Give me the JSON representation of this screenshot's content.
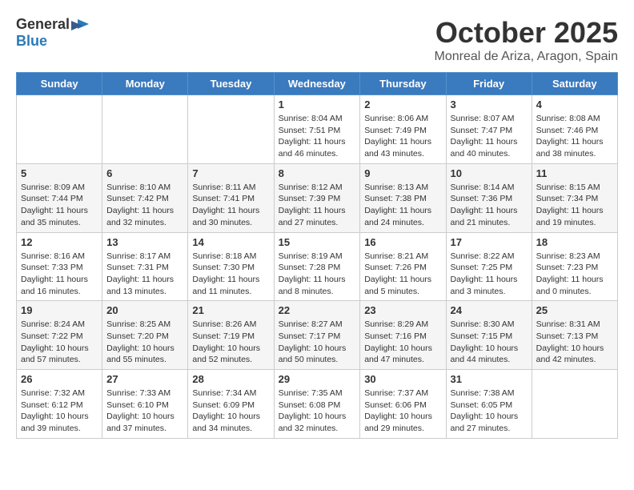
{
  "header": {
    "logo_general": "General",
    "logo_blue": "Blue",
    "month_title": "October 2025",
    "location": "Monreal de Ariza, Aragon, Spain"
  },
  "days_of_week": [
    "Sunday",
    "Monday",
    "Tuesday",
    "Wednesday",
    "Thursday",
    "Friday",
    "Saturday"
  ],
  "weeks": [
    [
      {
        "day": "",
        "info": ""
      },
      {
        "day": "",
        "info": ""
      },
      {
        "day": "",
        "info": ""
      },
      {
        "day": "1",
        "info": "Sunrise: 8:04 AM\nSunset: 7:51 PM\nDaylight: 11 hours and 46 minutes."
      },
      {
        "day": "2",
        "info": "Sunrise: 8:06 AM\nSunset: 7:49 PM\nDaylight: 11 hours and 43 minutes."
      },
      {
        "day": "3",
        "info": "Sunrise: 8:07 AM\nSunset: 7:47 PM\nDaylight: 11 hours and 40 minutes."
      },
      {
        "day": "4",
        "info": "Sunrise: 8:08 AM\nSunset: 7:46 PM\nDaylight: 11 hours and 38 minutes."
      }
    ],
    [
      {
        "day": "5",
        "info": "Sunrise: 8:09 AM\nSunset: 7:44 PM\nDaylight: 11 hours and 35 minutes."
      },
      {
        "day": "6",
        "info": "Sunrise: 8:10 AM\nSunset: 7:42 PM\nDaylight: 11 hours and 32 minutes."
      },
      {
        "day": "7",
        "info": "Sunrise: 8:11 AM\nSunset: 7:41 PM\nDaylight: 11 hours and 30 minutes."
      },
      {
        "day": "8",
        "info": "Sunrise: 8:12 AM\nSunset: 7:39 PM\nDaylight: 11 hours and 27 minutes."
      },
      {
        "day": "9",
        "info": "Sunrise: 8:13 AM\nSunset: 7:38 PM\nDaylight: 11 hours and 24 minutes."
      },
      {
        "day": "10",
        "info": "Sunrise: 8:14 AM\nSunset: 7:36 PM\nDaylight: 11 hours and 21 minutes."
      },
      {
        "day": "11",
        "info": "Sunrise: 8:15 AM\nSunset: 7:34 PM\nDaylight: 11 hours and 19 minutes."
      }
    ],
    [
      {
        "day": "12",
        "info": "Sunrise: 8:16 AM\nSunset: 7:33 PM\nDaylight: 11 hours and 16 minutes."
      },
      {
        "day": "13",
        "info": "Sunrise: 8:17 AM\nSunset: 7:31 PM\nDaylight: 11 hours and 13 minutes."
      },
      {
        "day": "14",
        "info": "Sunrise: 8:18 AM\nSunset: 7:30 PM\nDaylight: 11 hours and 11 minutes."
      },
      {
        "day": "15",
        "info": "Sunrise: 8:19 AM\nSunset: 7:28 PM\nDaylight: 11 hours and 8 minutes."
      },
      {
        "day": "16",
        "info": "Sunrise: 8:21 AM\nSunset: 7:26 PM\nDaylight: 11 hours and 5 minutes."
      },
      {
        "day": "17",
        "info": "Sunrise: 8:22 AM\nSunset: 7:25 PM\nDaylight: 11 hours and 3 minutes."
      },
      {
        "day": "18",
        "info": "Sunrise: 8:23 AM\nSunset: 7:23 PM\nDaylight: 11 hours and 0 minutes."
      }
    ],
    [
      {
        "day": "19",
        "info": "Sunrise: 8:24 AM\nSunset: 7:22 PM\nDaylight: 10 hours and 57 minutes."
      },
      {
        "day": "20",
        "info": "Sunrise: 8:25 AM\nSunset: 7:20 PM\nDaylight: 10 hours and 55 minutes."
      },
      {
        "day": "21",
        "info": "Sunrise: 8:26 AM\nSunset: 7:19 PM\nDaylight: 10 hours and 52 minutes."
      },
      {
        "day": "22",
        "info": "Sunrise: 8:27 AM\nSunset: 7:17 PM\nDaylight: 10 hours and 50 minutes."
      },
      {
        "day": "23",
        "info": "Sunrise: 8:29 AM\nSunset: 7:16 PM\nDaylight: 10 hours and 47 minutes."
      },
      {
        "day": "24",
        "info": "Sunrise: 8:30 AM\nSunset: 7:15 PM\nDaylight: 10 hours and 44 minutes."
      },
      {
        "day": "25",
        "info": "Sunrise: 8:31 AM\nSunset: 7:13 PM\nDaylight: 10 hours and 42 minutes."
      }
    ],
    [
      {
        "day": "26",
        "info": "Sunrise: 7:32 AM\nSunset: 6:12 PM\nDaylight: 10 hours and 39 minutes."
      },
      {
        "day": "27",
        "info": "Sunrise: 7:33 AM\nSunset: 6:10 PM\nDaylight: 10 hours and 37 minutes."
      },
      {
        "day": "28",
        "info": "Sunrise: 7:34 AM\nSunset: 6:09 PM\nDaylight: 10 hours and 34 minutes."
      },
      {
        "day": "29",
        "info": "Sunrise: 7:35 AM\nSunset: 6:08 PM\nDaylight: 10 hours and 32 minutes."
      },
      {
        "day": "30",
        "info": "Sunrise: 7:37 AM\nSunset: 6:06 PM\nDaylight: 10 hours and 29 minutes."
      },
      {
        "day": "31",
        "info": "Sunrise: 7:38 AM\nSunset: 6:05 PM\nDaylight: 10 hours and 27 minutes."
      },
      {
        "day": "",
        "info": ""
      }
    ]
  ]
}
